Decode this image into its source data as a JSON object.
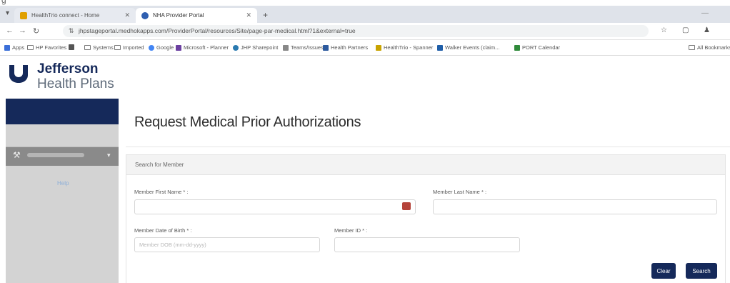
{
  "window": {
    "top_fragment": "g"
  },
  "browser": {
    "tabs": [
      {
        "title": "HealthTrio connect - Home",
        "color": "#e0a000"
      },
      {
        "title": "NHA Provider Portal",
        "color": "#2f5fb0"
      }
    ],
    "new_tab": "+",
    "address": "jhpstageportal.medhokapps.com/ProviderPortal/resources/Site/page-par-medical.html?1&external=true",
    "bookmarks": [
      {
        "label": "Apps",
        "color": "#3b6fd8"
      },
      {
        "label": "HP Favorites",
        "color": "#777777"
      },
      {
        "label": "",
        "color": "#555555"
      },
      {
        "label": "Systems",
        "color": "#777777"
      },
      {
        "label": "Imported",
        "color": "#777777"
      },
      {
        "label": "Google",
        "color": "#4285f4"
      },
      {
        "label": "Microsoft - Planner",
        "color": "#6b3fa0"
      },
      {
        "label": "JHP Sharepoint",
        "color": "#2a7ab0"
      },
      {
        "label": "Teams/Issues",
        "color": "#888888"
      },
      {
        "label": "Health Partners",
        "color": "#2c5a9e"
      },
      {
        "label": "HealthTrio - Spanner",
        "color": "#c8a300"
      },
      {
        "label": "Walker Events (claim...",
        "color": "#1f5ea8"
      },
      {
        "label": "PORT Calendar",
        "color": "#2f8a3a"
      },
      {
        "label": "All Bookmarks",
        "color": "#777777"
      }
    ]
  },
  "brand": {
    "line1": "Jefferson",
    "line2": "Health Plans",
    "color": "#15295a"
  },
  "sidebar": {
    "help_link": "Help"
  },
  "page": {
    "title": "Request Medical Prior Authorizations",
    "panel_title": "Search for Member",
    "first_name_label": "Member First Name * :",
    "last_name_label": "Member Last Name * :",
    "dob_label": "Member Date of Birth * :",
    "dob_placeholder": "Member DOB (mm-dd-yyyy)",
    "member_id_label": "Member ID * :",
    "clear_label": "Clear",
    "search_label": "Search"
  }
}
